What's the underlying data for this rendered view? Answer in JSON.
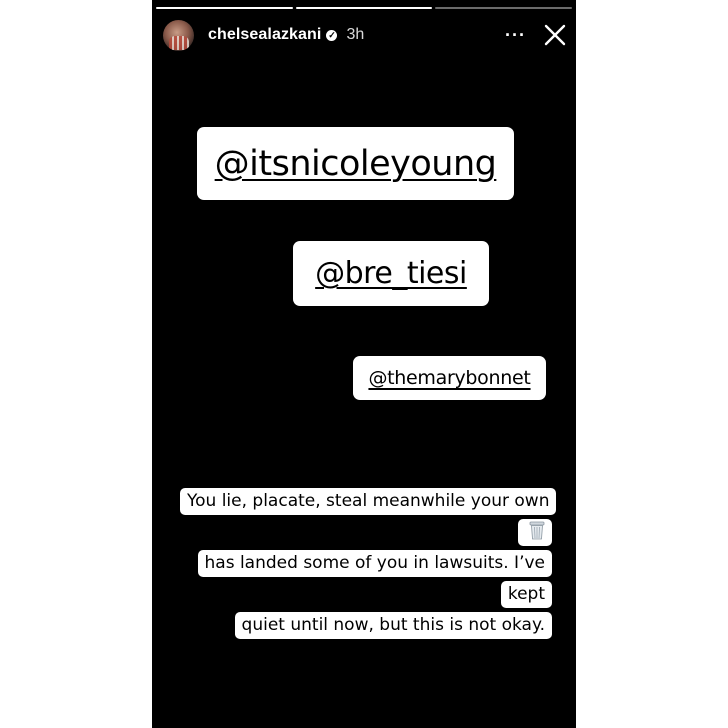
{
  "story": {
    "progress": [
      1,
      1,
      0.0
    ],
    "header": {
      "username": "chelsealazkani",
      "time": "3h",
      "more_icon": "more-horizontal-icon",
      "close_icon": "close-icon",
      "verified_icon": "verified-badge-icon"
    },
    "mentions": [
      {
        "label": "@itsnicoleyoung"
      },
      {
        "label": "@bre_tiesi"
      },
      {
        "label": "@themarybonnet"
      }
    ],
    "caption": {
      "line1": "You lie, placate, steal meanwhile your own",
      "line1_emoji": "wastebasket-icon",
      "line2": "has landed some of you in lawsuits. I’ve kept",
      "line3": "quiet until now, but this is not okay."
    }
  },
  "colors": {
    "background": "#000000",
    "page": "#ffffff",
    "sticker": "#ffffff",
    "text": "#000000"
  }
}
